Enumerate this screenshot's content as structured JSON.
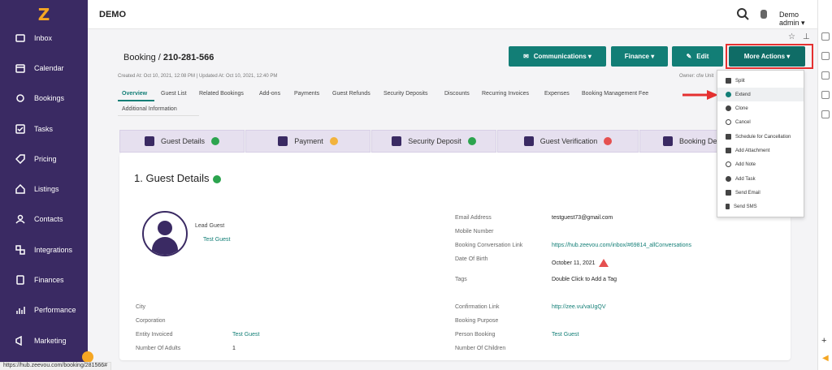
{
  "app": {
    "name": "DEMO",
    "user": "Demo admin"
  },
  "sidebar": {
    "items": [
      {
        "label": "Inbox",
        "icon": "inbox-icon"
      },
      {
        "label": "Calendar",
        "icon": "calendar-icon"
      },
      {
        "label": "Bookings",
        "icon": "bookings-icon"
      },
      {
        "label": "Tasks",
        "icon": "tasks-icon"
      },
      {
        "label": "Pricing",
        "icon": "tag-icon"
      },
      {
        "label": "Listings",
        "icon": "home-icon"
      },
      {
        "label": "Contacts",
        "icon": "contacts-icon"
      },
      {
        "label": "Integrations",
        "icon": "integrations-icon"
      },
      {
        "label": "Finances",
        "icon": "finances-icon"
      },
      {
        "label": "Performance",
        "icon": "performance-icon"
      },
      {
        "label": "Marketing",
        "icon": "marketing-icon"
      }
    ]
  },
  "booking": {
    "title_prefix": "Booking / ",
    "number": "210-281-566",
    "created": "Created At: Oct 10, 2021, 12:08 PM",
    "updated": "Updated At: Oct 10, 2021, 12:40 PM",
    "owner": "Owner: cfw Unit"
  },
  "actions": {
    "communications": "Communications",
    "finance": "Finance",
    "edit": "Edit",
    "more": "More Actions"
  },
  "tabs": [
    "Overview",
    "Guest List",
    "Related Bookings",
    "Add-ons",
    "Payments",
    "Guest Refunds",
    "Security Deposits",
    "Discounts",
    "Recurring Invoices",
    "Expenses",
    "Booking Management Fee"
  ],
  "tabs2": [
    "Additional Information"
  ],
  "wizard": [
    {
      "label": "Guest Details",
      "status": "ok"
    },
    {
      "label": "Payment",
      "status": "warn"
    },
    {
      "label": "Security Deposit",
      "status": "ok"
    },
    {
      "label": "Guest Verification",
      "status": "bad"
    },
    {
      "label": "Booking De",
      "status": ""
    }
  ],
  "guest": {
    "section_title": "1. Guest Details",
    "lead_label": "Lead Guest",
    "lead_name": "Test Guest",
    "right": [
      {
        "label": "Email Address",
        "value": "testguest73@gmail.com"
      },
      {
        "label": "Mobile Number",
        "value": ""
      },
      {
        "label": "Booking Conversation Link",
        "value": "https://hub.zeevou.com/inbox/#69814_allConversations"
      },
      {
        "label": "Date Of Birth",
        "value": "October 11, 2021"
      },
      {
        "label": "Tags",
        "value": "Double Click to Add a Tag"
      },
      {
        "label": "Confirmation Link",
        "value": "http://zee.vu/vaUgQV"
      },
      {
        "label": "Booking Purpose",
        "value": ""
      },
      {
        "label": "Person Booking",
        "value": "Test Guest"
      },
      {
        "label": "Number Of Children",
        "value": ""
      }
    ],
    "left": [
      {
        "label": "City",
        "value": ""
      },
      {
        "label": "Corporation",
        "value": ""
      },
      {
        "label": "Entity Invoiced",
        "value": "Test Guest"
      },
      {
        "label": "Number Of Adults",
        "value": "1"
      }
    ]
  },
  "dropdown": [
    "Split",
    "Extend",
    "Clone",
    "Cancel",
    "Schedule for Cancellation",
    "Add Attachment",
    "Add Note",
    "Add Task",
    "Send Email",
    "Send SMS"
  ],
  "status_url": "https://hub.zeevou.com/booking/281566#"
}
